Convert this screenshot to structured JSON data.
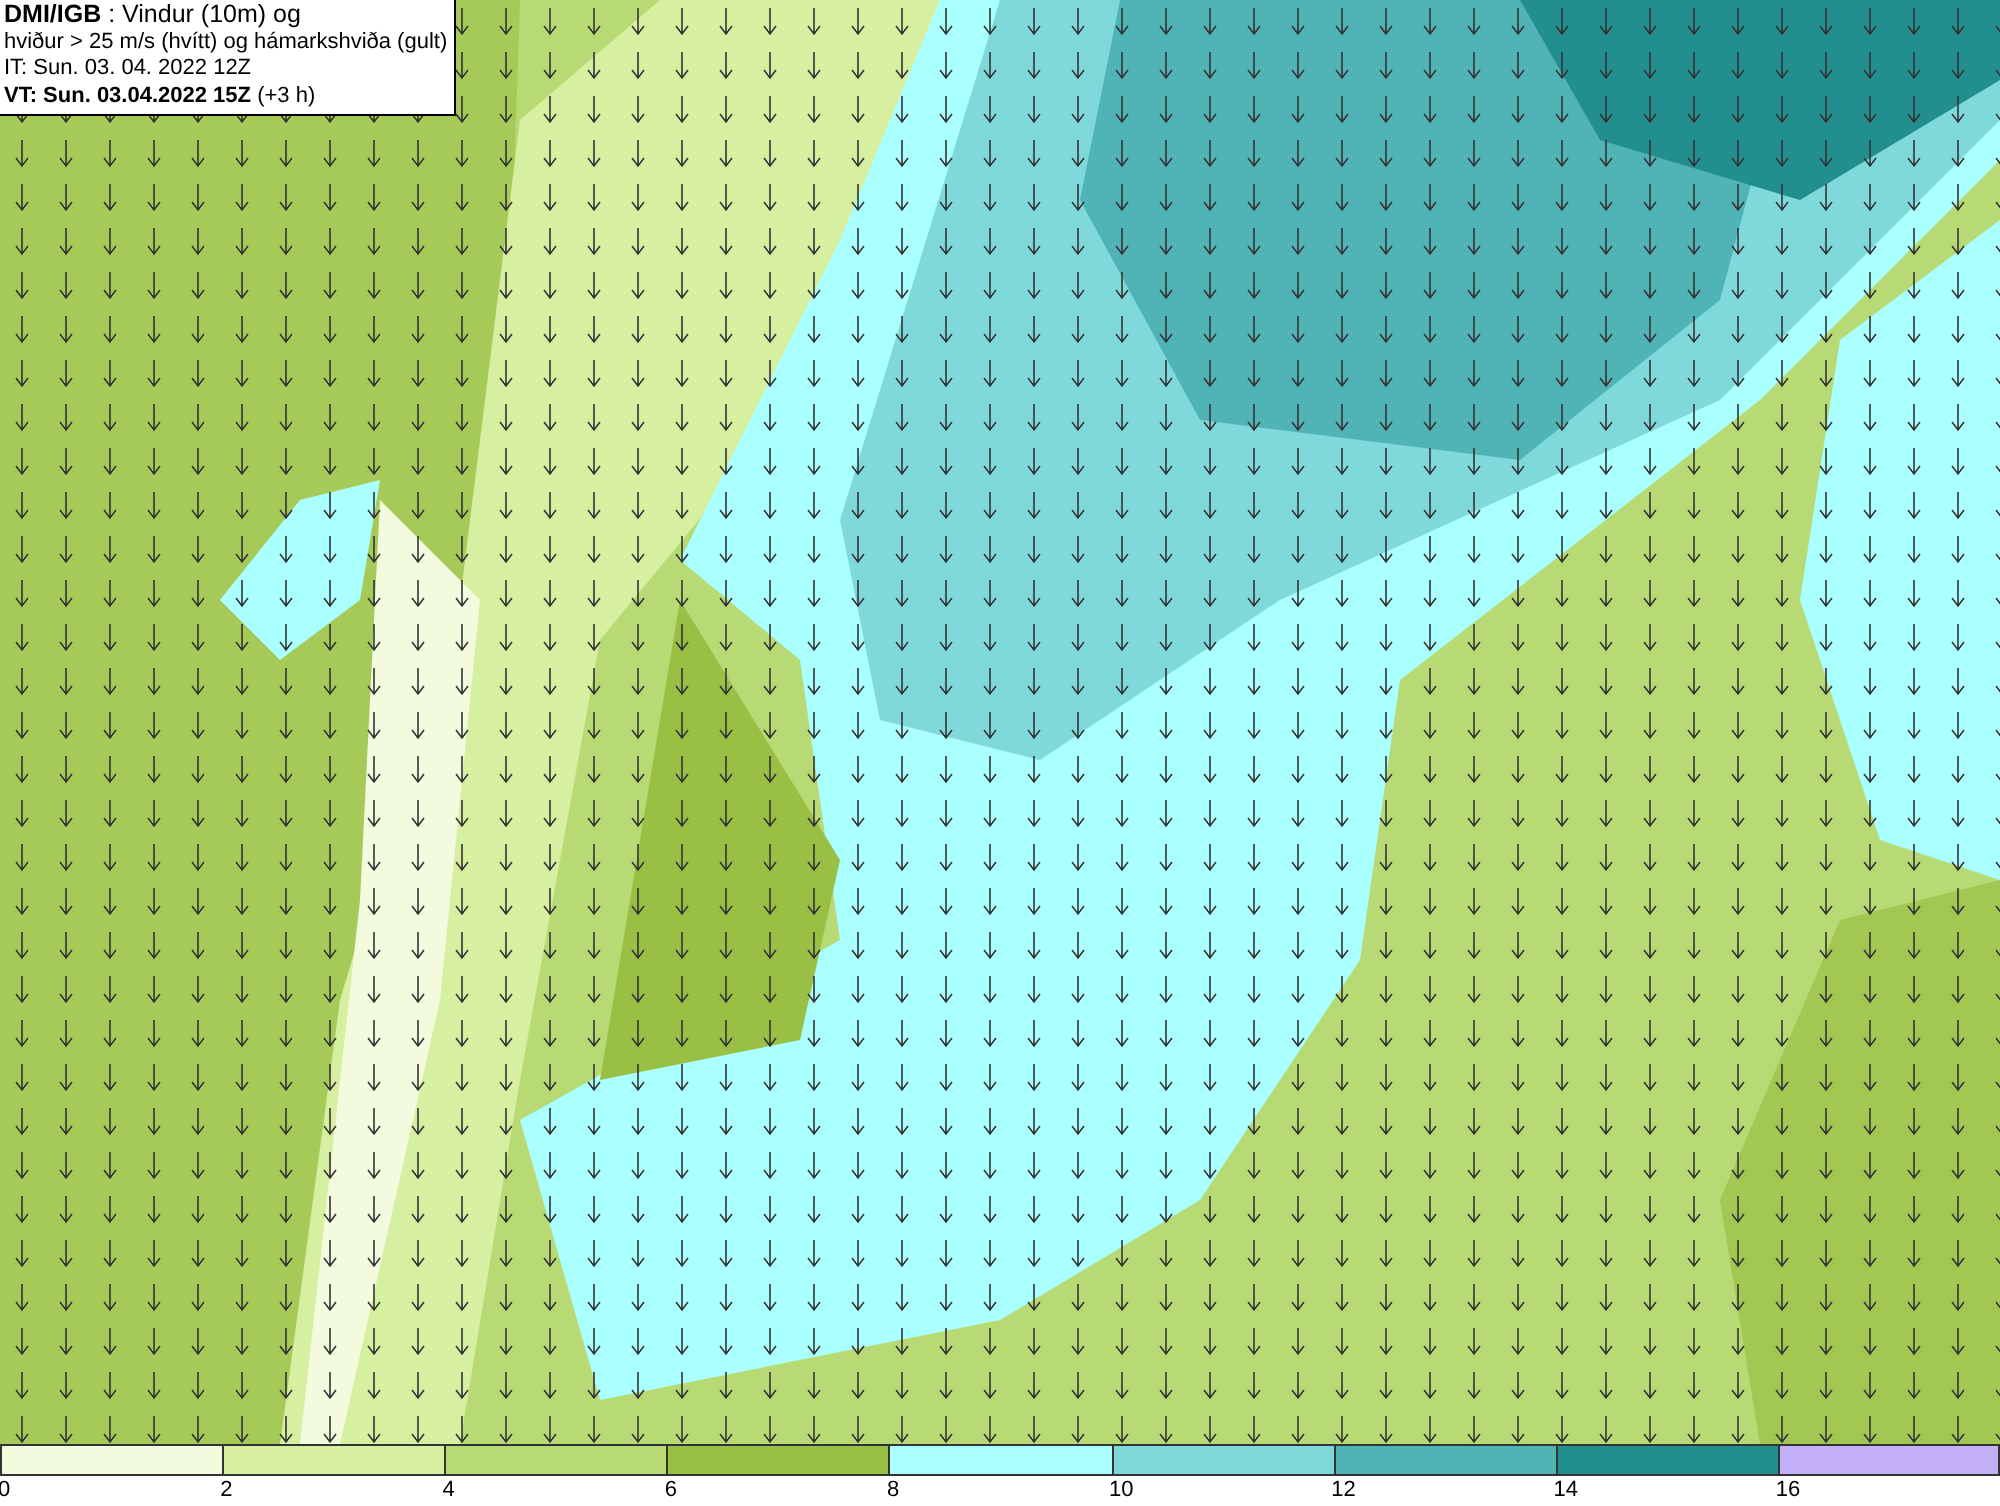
{
  "header": {
    "lines": [
      "**DMI/IGB** : Vindur (10m) og",
      "hviður > 25 m/s (hvítt) og hámarkshviða (gult)",
      "IT: Sun. 03. 04. 2022 12Z",
      "**VT: Sun. 03.04.2022 15Z** (+3 h)"
    ]
  },
  "legend": [
    {
      "label": "0",
      "color": "#f3fbdf"
    },
    {
      "label": "2",
      "color": "#d6efa0"
    },
    {
      "label": "4",
      "color": "#b8da75"
    },
    {
      "label": "6",
      "color": "#99bf45"
    },
    {
      "label": "8",
      "color": "#aaffff"
    },
    {
      "label": "10",
      "color": "#7fd9db"
    },
    {
      "label": "12",
      "color": "#50b3b5"
    },
    {
      "label": "14",
      "color": "#228e8e"
    },
    {
      "label": "16",
      "color": "#c3b0f7"
    }
  ]
}
